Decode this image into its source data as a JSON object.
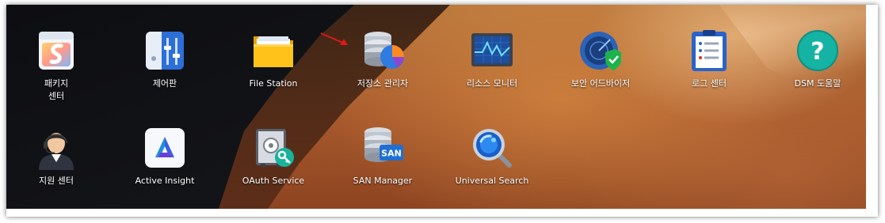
{
  "apps_row1": [
    {
      "label_line1": "패키지",
      "label_line2": "센터",
      "icon": "package-center-icon"
    },
    {
      "label": "제어판",
      "icon": "control-panel-icon"
    },
    {
      "label": "File Station",
      "icon": "folder-icon"
    },
    {
      "label": "저장소 관리자",
      "icon": "storage-manager-icon"
    },
    {
      "label": "리소스 모니터",
      "icon": "resource-monitor-icon"
    },
    {
      "label": "보안 어드바이저",
      "icon": "security-advisor-icon"
    },
    {
      "label": "로그 센터",
      "icon": "log-center-icon"
    },
    {
      "label": "DSM 도움말",
      "icon": "help-icon"
    }
  ],
  "apps_row2": [
    {
      "label": "지원 센터",
      "icon": "support-center-icon"
    },
    {
      "label": "Active Insight",
      "icon": "active-insight-icon"
    },
    {
      "label": "OAuth Service",
      "icon": "oauth-service-icon"
    },
    {
      "label": "SAN Manager",
      "icon": "san-manager-icon"
    },
    {
      "label": "Universal Search",
      "icon": "universal-search-icon"
    }
  ],
  "san_badge": "SAN",
  "help_glyph": "?",
  "colors": {
    "arrow": "#e01818",
    "label_text": "#ffffff"
  }
}
